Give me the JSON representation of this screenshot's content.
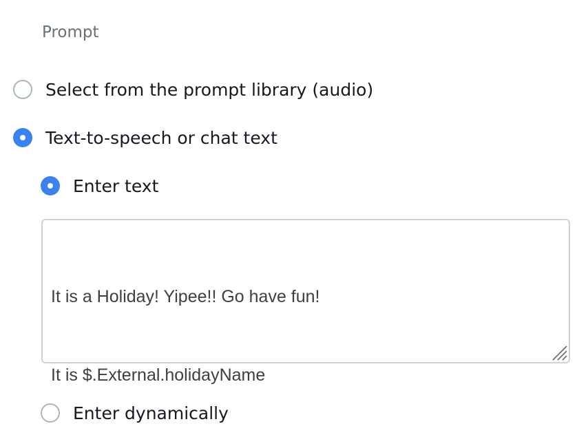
{
  "prompt_section": {
    "label": "Prompt"
  },
  "options": {
    "library": {
      "label": "Select from the prompt library (audio)",
      "selected": false
    },
    "tts": {
      "label": "Text-to-speech or chat text",
      "selected": true
    }
  },
  "tts_options": {
    "enter_text": {
      "label": "Enter text",
      "selected": true
    },
    "enter_dynamically": {
      "label": "Enter dynamically",
      "selected": false
    }
  },
  "text_input": {
    "line_1": "It is a Holiday! Yipee!! Go have fun!",
    "line_2": "It is $.External.holidayName"
  },
  "colors": {
    "accent": "#3b82f0",
    "muted_label": "#687078",
    "border": "#cfd3d6"
  }
}
